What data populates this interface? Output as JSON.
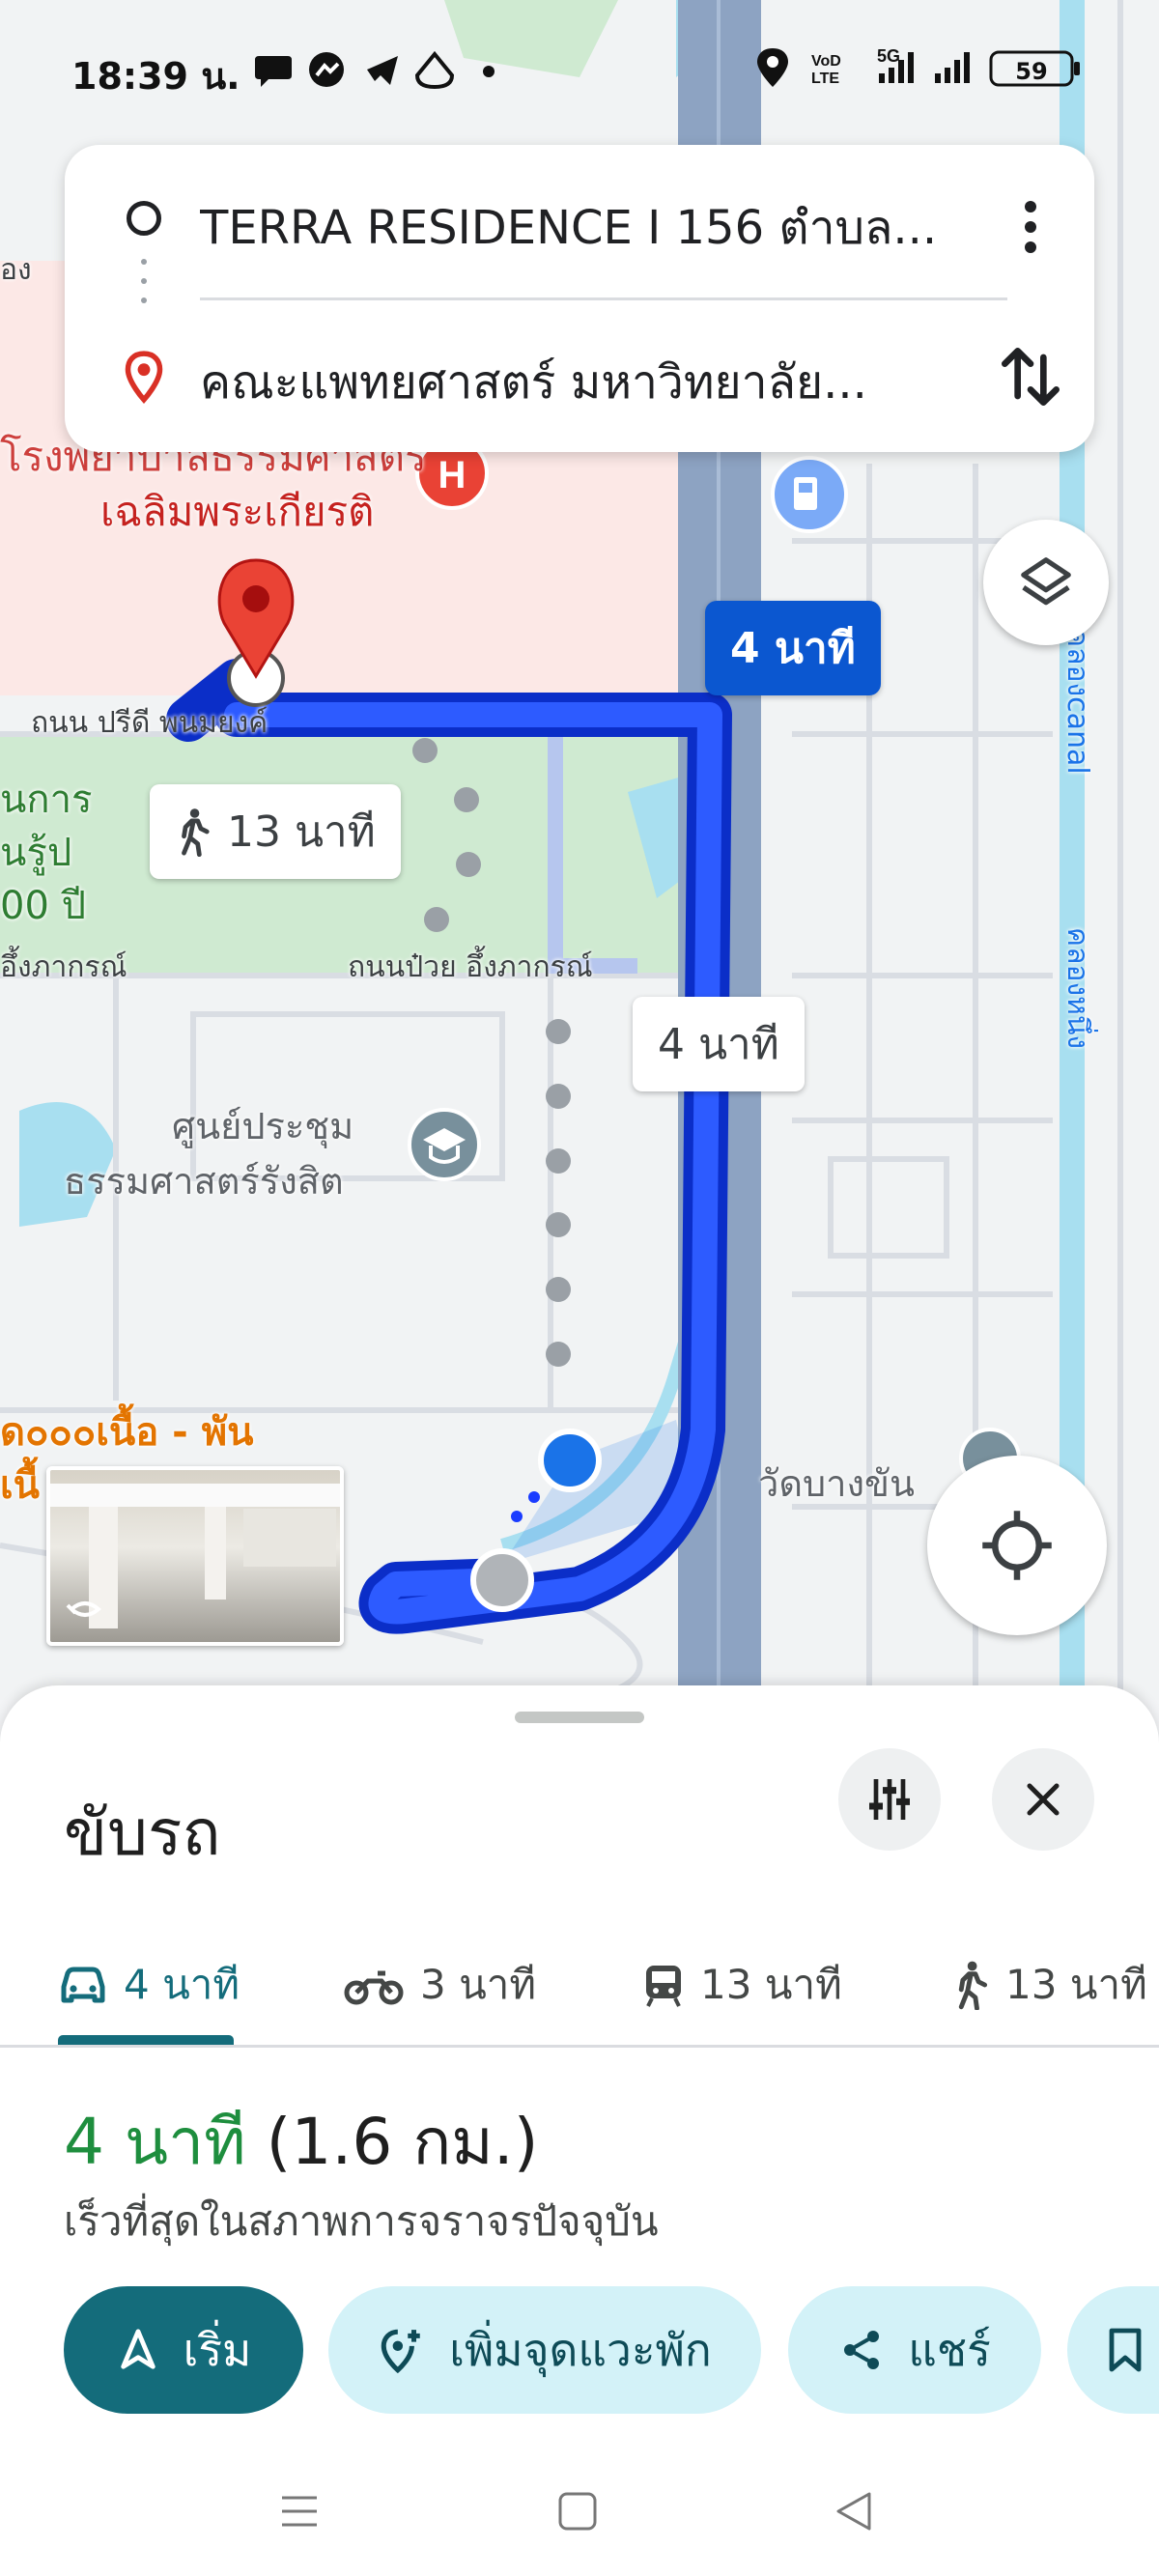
{
  "status_bar": {
    "time": "18:39 น.",
    "battery": "59",
    "network": "5G",
    "volte": "VoLTE"
  },
  "route_card": {
    "origin": "TERRA RESIDENCE I 156 ตำบล...",
    "destination": "คณะแพทยศาสตร์ มหาวิทยาลัย...",
    "icons": [
      "origin-circle-icon",
      "destination-pin-icon",
      "more-vert-icon",
      "swap-icon"
    ]
  },
  "map": {
    "labels": {
      "hospital_line1": "โรงพยาบาลธรรมศาสตร์",
      "hospital_line2": "เฉลิมพระเกียรติ",
      "road_preedee": "ถนน ปรีดี พนมยงค์",
      "road_puay": "ถนนป๋วย อึ้งภากรณ์",
      "road_puay_left": "อึ้งภากรณ์",
      "green_line1": "นการ",
      "green_line2": "นรู้ป",
      "green_line3": "00 ปี",
      "convention_line1": "ศูนย์ประชุม",
      "convention_line2": "ธรรมศาสตร์รังสิต",
      "restaurant_line1": "ด๐๐๐เนื้อ - พัน",
      "restaurant_line2": "เนื้",
      "temple": "วัดบางขัน",
      "canal_top": "คลองcanal",
      "canal_mid": "คลองหนึ่ง",
      "left_edge": "อง"
    },
    "duration_chips": {
      "drive_primary": "4 นาที",
      "walk": "13 นาที",
      "drive_alt": "4 นาที"
    },
    "colors": {
      "route": "#1a3cff",
      "route_outline": "#0b2ec8",
      "highway": "#8da3c2",
      "green_area": "#c8e6c9",
      "hospital_area": "#fce8e6",
      "water": "#a8dff0"
    }
  },
  "sheet": {
    "title": "ขับรถ",
    "tabs": [
      {
        "label": "4 นาที",
        "icon": "car-icon",
        "active": true
      },
      {
        "label": "3 นาที",
        "icon": "motorcycle-icon",
        "active": false
      },
      {
        "label": "13 นาที",
        "icon": "transit-icon",
        "active": false
      },
      {
        "label": "13 นาที",
        "icon": "walk-icon",
        "active": false
      }
    ],
    "summary_time": "4 นาที",
    "summary_distance": "(1.6 กม.)",
    "summary_sub": "เร็วที่สุดในสภาพการจราจรปัจจุบัน",
    "actions": {
      "start": "เริ่ม",
      "add_stop": "เพิ่มจุดแวะพัก",
      "share": "แชร์"
    }
  }
}
